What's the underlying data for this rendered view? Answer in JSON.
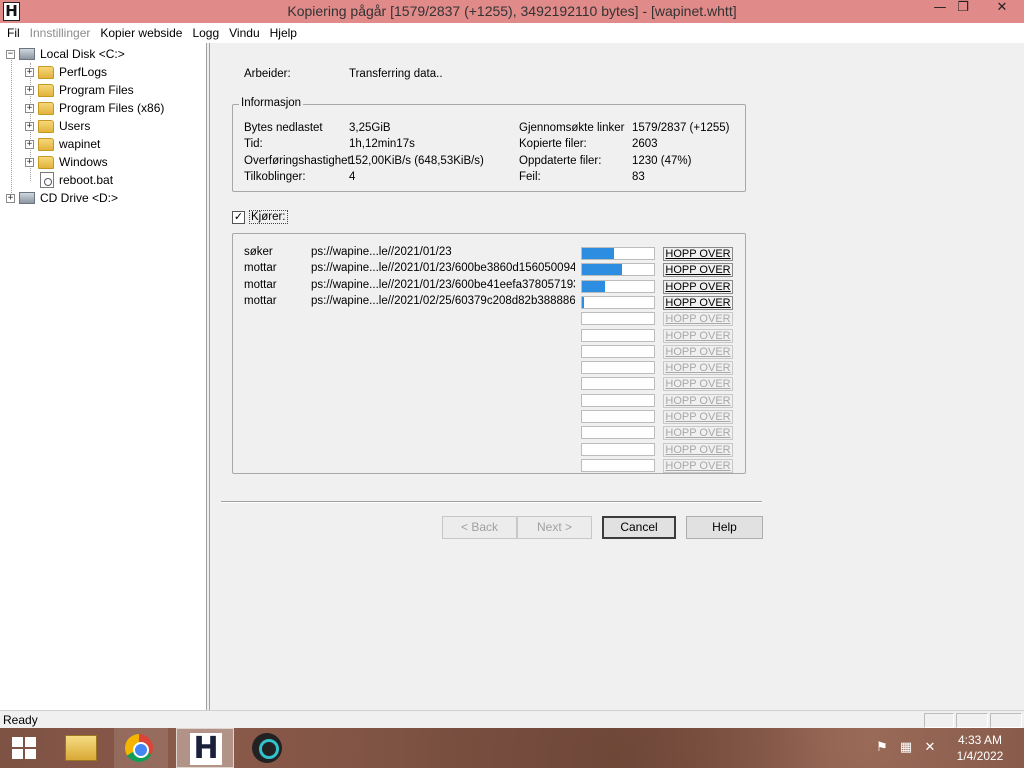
{
  "window": {
    "logo": "H",
    "title": "Kopiering pågår [1579/2837 (+1255), 3492192110 bytes] - [wapinet.whtt]",
    "minimize": "—",
    "maximize": "❐",
    "close": "✕"
  },
  "menu": [
    "Fil",
    "Innstillinger",
    "Kopier webside",
    "Logg",
    "Vindu",
    "Hjelp"
  ],
  "tree": {
    "root": "Local Disk <C:>",
    "children": [
      "PerfLogs",
      "Program Files",
      "Program Files (x86)",
      "Users",
      "wapinet",
      "Windows",
      "reboot.bat"
    ],
    "cd_drive": "CD Drive <D:>",
    "expand_symbol": "+",
    "collapse_symbol": "−"
  },
  "main": {
    "worker_label": "Arbeider:",
    "worker_value": "Transferring data..",
    "info_title": "Informasjon",
    "info_left": [
      {
        "label": "Bytes nedlastet",
        "value": "3,25GiB"
      },
      {
        "label": "Tid:",
        "value": "1h,12min17s"
      },
      {
        "label": "Overføringshastighet",
        "value": "152,00KiB/s (648,53KiB/s)"
      },
      {
        "label": "Tilkoblinger:",
        "value": "4"
      }
    ],
    "info_right": [
      {
        "label": "Gjennomsøkte linker",
        "value": "1579/2837 (+1255)"
      },
      {
        "label": "Kopierte filer:",
        "value": "2603"
      },
      {
        "label": "Oppdaterte filer:",
        "value": "1230 (47%)"
      },
      {
        "label": "Feil:",
        "value": "83"
      }
    ],
    "running_label": "Kjører:",
    "running_checked": "✓",
    "transfers": [
      {
        "status": "søker",
        "url": "ps://wapine...le//2021/01/23",
        "progress": 0.45
      },
      {
        "status": "mottar",
        "url": "ps://wapine...le//2021/01/23/600be3860d156050094(",
        "progress": 0.55
      },
      {
        "status": "mottar",
        "url": "ps://wapine...le//2021/01/23/600be41eefa378057193",
        "progress": 0.32
      },
      {
        "status": "mottar",
        "url": "ps://wapine...le//2021/02/25/60379c208d82b388886",
        "progress": 0.03
      }
    ],
    "skip_label": "HOPP OVER",
    "empty_slots": 10,
    "buttons": {
      "back": "< Back",
      "next": "Next >",
      "cancel": "Cancel",
      "help": "Help"
    }
  },
  "status": {
    "text": "Ready"
  },
  "taskbar": {
    "time": "4:33 AM",
    "date": "1/4/2022",
    "httrack_logo": "H",
    "tray_flag": "⚑",
    "tray_network": "▦",
    "tray_volume": "✕"
  }
}
